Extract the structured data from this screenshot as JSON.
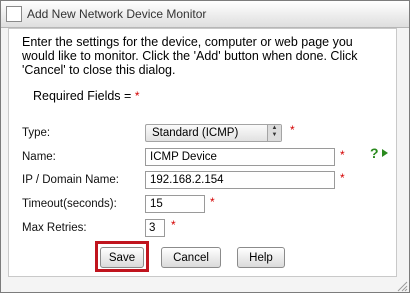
{
  "window": {
    "title": "Add New Network Device Monitor"
  },
  "intro": "Enter the settings for the device, computer or web page you would like to monitor. Click the 'Add' button when done. Click 'Cancel' to close this dialog.",
  "required_label": "Required Fields =",
  "required_star": "*",
  "fields": {
    "type": {
      "label": "Type:",
      "value": "Standard (ICMP)"
    },
    "name": {
      "label": "Name:",
      "value": "ICMP Device"
    },
    "ip": {
      "label": "IP / Domain Name:",
      "value": "192.168.2.154"
    },
    "timeout": {
      "label": "Timeout(seconds):",
      "value": "15"
    },
    "retries": {
      "label": "Max Retries:",
      "value": "3"
    }
  },
  "buttons": {
    "save": "Save",
    "cancel": "Cancel",
    "help": "Help"
  },
  "colors": {
    "highlight": "#c0141e",
    "required": "#d40000",
    "help_icon": "#2a8a1e"
  },
  "icons": {
    "help": "help-arrow-icon",
    "select_arrows": "updown-arrows-icon"
  }
}
